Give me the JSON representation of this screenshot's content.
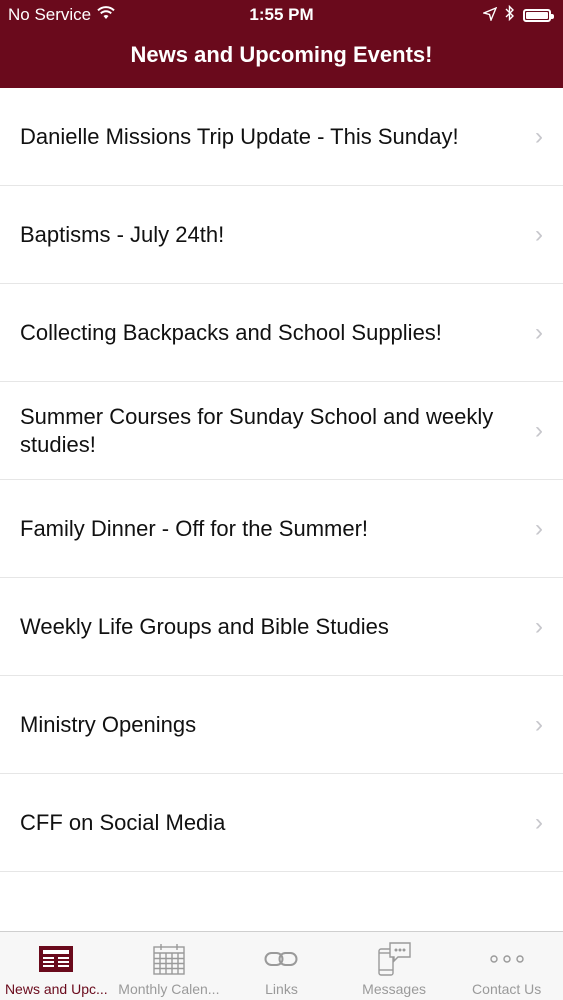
{
  "status_bar": {
    "carrier": "No Service",
    "time": "1:55 PM"
  },
  "header": {
    "title": "News and Upcoming Events!"
  },
  "list": {
    "items": [
      {
        "label": "Danielle Missions Trip Update  - This Sunday!"
      },
      {
        "label": "Baptisms - July 24th!"
      },
      {
        "label": "Collecting Backpacks and School Supplies!"
      },
      {
        "label": "Summer Courses for Sunday School and weekly studies!"
      },
      {
        "label": "Family Dinner - Off for the Summer!"
      },
      {
        "label": "Weekly Life Groups and Bible Studies"
      },
      {
        "label": "Ministry Openings"
      },
      {
        "label": "CFF on Social Media"
      }
    ]
  },
  "tabbar": {
    "tabs": [
      {
        "label": "News and Upc...",
        "icon": "newspaper-icon",
        "active": true
      },
      {
        "label": "Monthly Calen...",
        "icon": "calendar-icon",
        "active": false
      },
      {
        "label": "Links",
        "icon": "link-icon",
        "active": false
      },
      {
        "label": "Messages",
        "icon": "phone-chat-icon",
        "active": false
      },
      {
        "label": "Contact Us",
        "icon": "more-icon",
        "active": false
      }
    ]
  },
  "colors": {
    "brand": "#6a0a1c",
    "inactive_tab": "#9a9a9a",
    "chevron": "#c7c7cc"
  }
}
